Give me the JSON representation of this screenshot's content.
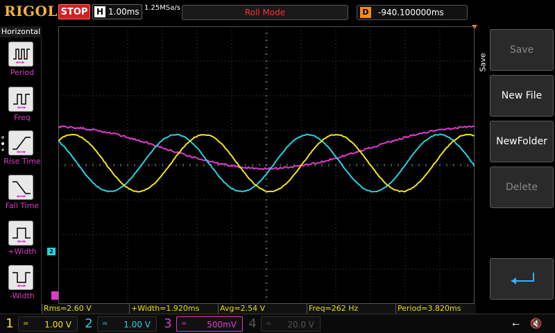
{
  "topbar": {
    "brand": "RIGOL",
    "run_state": "STOP",
    "timebase_letter": "H",
    "timebase": "1.00ms",
    "sample_rate": "1.25MSa/s",
    "mode": "Roll Mode",
    "delay_letter": "D",
    "delay": "-940.100000ms"
  },
  "colors": {
    "ch1": "#f5e617",
    "ch2": "#27d3e6",
    "ch3": "#e03ccc",
    "ch4": "#3a5a9a",
    "trigger": "#f28a1c",
    "stop": "#d42020"
  },
  "left_menu": {
    "title": "Horizontal",
    "items": [
      {
        "label": "Period",
        "icon": "period-icon"
      },
      {
        "label": "Freq",
        "icon": "frequency-icon"
      },
      {
        "label": "Rise Time",
        "icon": "rise-time-icon"
      },
      {
        "label": "Fall Time",
        "icon": "fall-time-icon"
      },
      {
        "label": "+Width",
        "icon": "positive-width-icon"
      },
      {
        "label": "-Width",
        "icon": "negative-width-icon"
      }
    ]
  },
  "channel_markers": {
    "ch2": "2"
  },
  "measurements": [
    "Rms=2.60 V",
    "+Width=1.920ms",
    "Avg=2.54 V",
    "Freq=262 Hz",
    "Period=3.820ms"
  ],
  "channels": [
    {
      "num": "1",
      "coupling": "=",
      "scale": "1.00 V"
    },
    {
      "num": "2",
      "coupling": "=",
      "scale": "1.00 V"
    },
    {
      "num": "3",
      "coupling": "=",
      "scale": "500mV"
    },
    {
      "num": "4",
      "coupling": "=",
      "scale": "20.0 V"
    }
  ],
  "right_menu": {
    "title": "Save",
    "buttons": [
      {
        "label": "Save",
        "enabled": false
      },
      {
        "label": "New File",
        "enabled": true
      },
      {
        "label": "NewFolder",
        "enabled": true
      },
      {
        "label": "Delete",
        "enabled": false
      }
    ]
  },
  "status_icons": [
    "usb-icon",
    "speaker-muted-icon"
  ]
}
